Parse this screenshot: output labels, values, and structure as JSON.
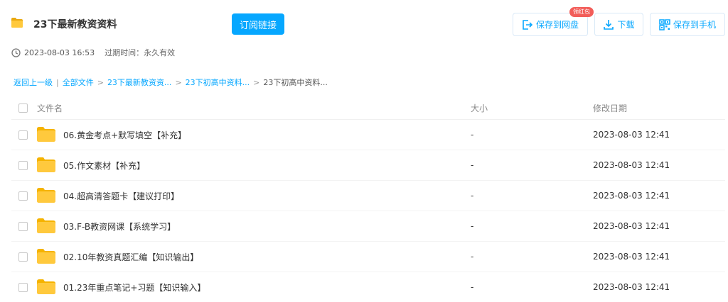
{
  "header": {
    "title": "23下最新教资资料",
    "subscribe_label": "订阅链接",
    "created_time": "2023-08-03 16:53",
    "expire_text": "过期时间：永久有效",
    "actions": {
      "save_label": "保存到网盘",
      "redpack_badge": "领红包",
      "download_label": "下载",
      "phone_label": "保存到手机"
    }
  },
  "breadcrumb": {
    "back": "返回上一级",
    "all": "全部文件",
    "level1": "23下最新教资资...",
    "level2": "23下初高中资料...",
    "current": "23下初高中资料..."
  },
  "list": {
    "columns": {
      "name": "文件名",
      "size": "大小",
      "date": "修改日期"
    },
    "rows": [
      {
        "name": "06.黄金考点+默写填空【补充】",
        "size": "-",
        "date": "2023-08-03 12:41"
      },
      {
        "name": "05.作文素材【补充】",
        "size": "-",
        "date": "2023-08-03 12:41"
      },
      {
        "name": "04.超高清答题卡【建议打印】",
        "size": "-",
        "date": "2023-08-03 12:41"
      },
      {
        "name": "03.F-B教资网课【系统学习】",
        "size": "-",
        "date": "2023-08-03 12:41"
      },
      {
        "name": "02.10年教资真题汇编【知识输出】",
        "size": "-",
        "date": "2023-08-03 12:41"
      },
      {
        "name": "01.23年重点笔记+习题【知识输入】",
        "size": "-",
        "date": "2023-08-03 12:41"
      }
    ]
  },
  "colors": {
    "accent": "#06a7ff",
    "folder": "#ffc93d",
    "badge": "#f25d59"
  },
  "icons": [
    "folder-icon",
    "clock-icon",
    "save-to-cloud-icon",
    "download-icon",
    "qrcode-icon",
    "checkbox"
  ]
}
